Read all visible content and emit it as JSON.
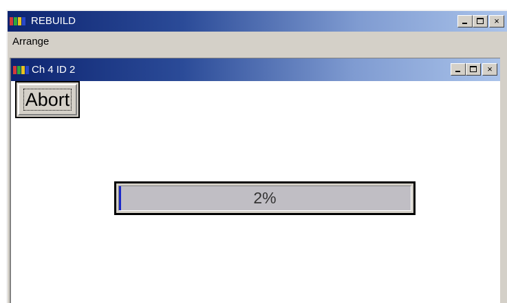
{
  "outer_window": {
    "title": "REBUILD",
    "minimize_label": "_",
    "maximize_label": "□",
    "close_label": "×"
  },
  "menu": {
    "items": [
      {
        "label": "Arrange"
      }
    ]
  },
  "child_window": {
    "title": "Ch 4 ID 2",
    "minimize_label": "_",
    "maximize_label": "□",
    "close_label": "×"
  },
  "abort_button": {
    "label": "Abort"
  },
  "progress": {
    "value_percent": 2,
    "label": "2%",
    "fill_color": "#1a28c8",
    "track_color": "#c0bec4"
  },
  "colors": {
    "titlebar_dark": "#0d2470",
    "titlebar_light": "#aac3ea",
    "face": "#d4d0c8"
  },
  "icons": [
    "app-icon",
    "minimize-icon",
    "maximize-icon",
    "close-icon"
  ]
}
